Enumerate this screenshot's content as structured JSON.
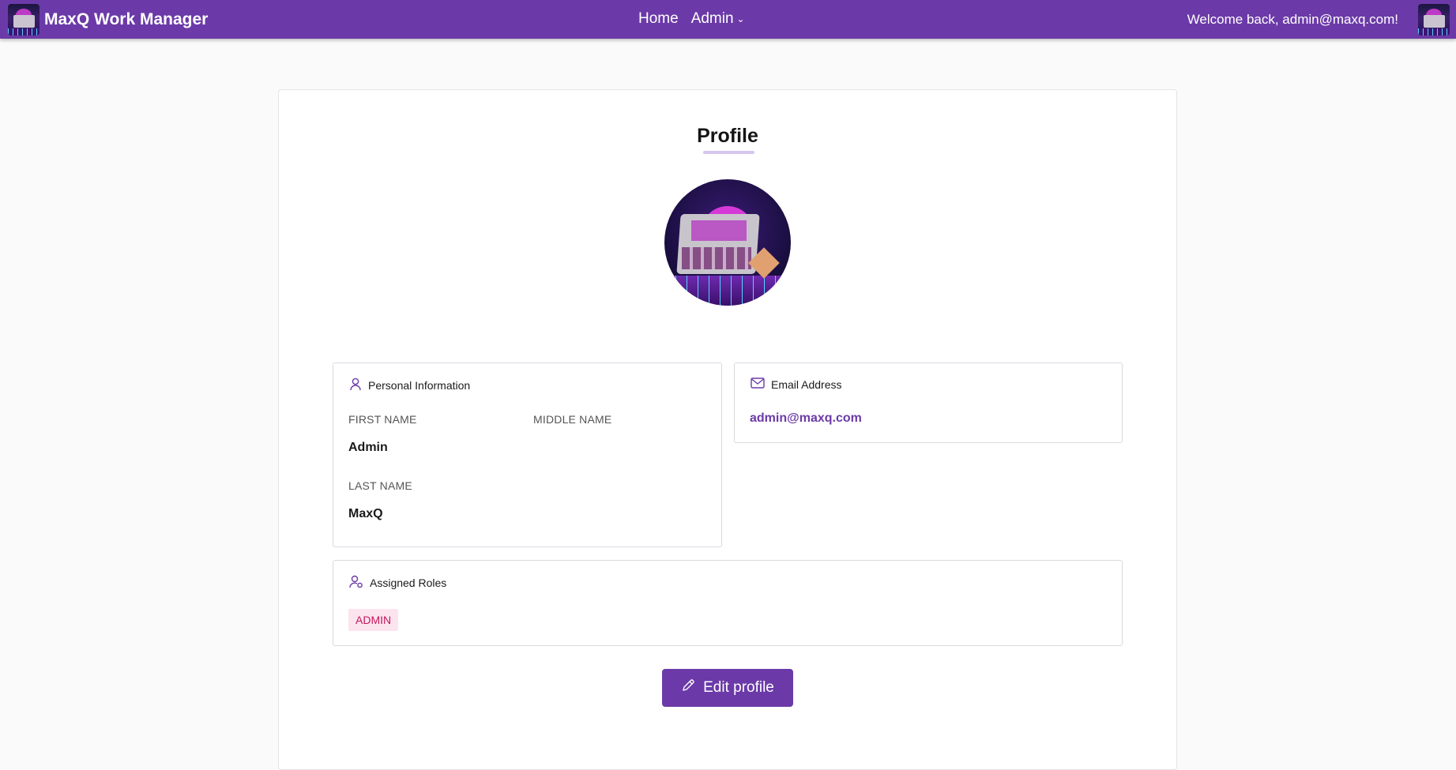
{
  "navbar": {
    "brand": "MaxQ Work Manager",
    "links": [
      {
        "label": "Home"
      },
      {
        "label": "Admin",
        "chevron": "⌄"
      }
    ],
    "welcome": "Welcome back, admin@maxq.com!",
    "bar_color": "#6b3aa8"
  },
  "page": {
    "title": "Profile"
  },
  "personal_info": {
    "heading": "Personal Information",
    "icon": "user-icon",
    "first_name_label": "FIRST NAME",
    "first_name": "Admin",
    "middle_name_label": "MIDDLE NAME",
    "middle_name": "",
    "last_name_label": "LAST NAME",
    "last_name": "MaxQ"
  },
  "email": {
    "heading": "Email Address",
    "icon": "mail-icon",
    "value": "admin@maxq.com"
  },
  "roles": {
    "heading": "Assigned Roles",
    "icon": "user-settings-icon",
    "items": [
      "ADMIN"
    ],
    "badge_color": "#c2185b"
  },
  "actions": {
    "edit_label": "Edit profile",
    "icon": "pencil-icon"
  }
}
